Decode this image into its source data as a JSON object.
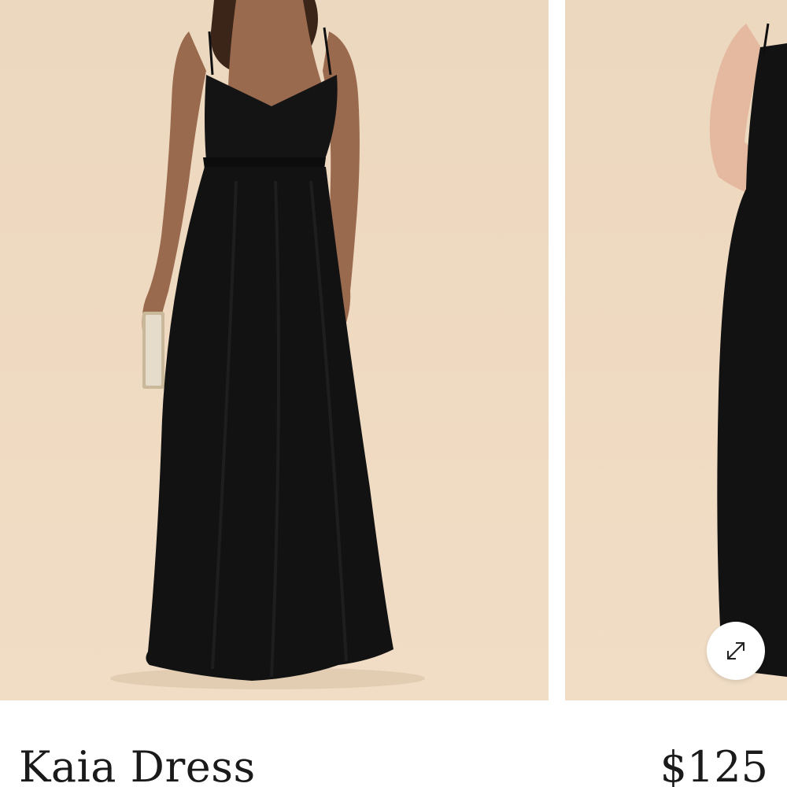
{
  "product": {
    "name": "Kaia Dress",
    "price": "$125"
  },
  "gallery": {
    "slides": [
      {
        "label": "black-dress-front-view"
      },
      {
        "label": "black-dress-alternate-model"
      }
    ],
    "expand_icon": "expand-arrows-icon"
  },
  "colors": {
    "backdrop": "#efdac1",
    "dress": "#121212",
    "text": "#1a1a1a"
  }
}
